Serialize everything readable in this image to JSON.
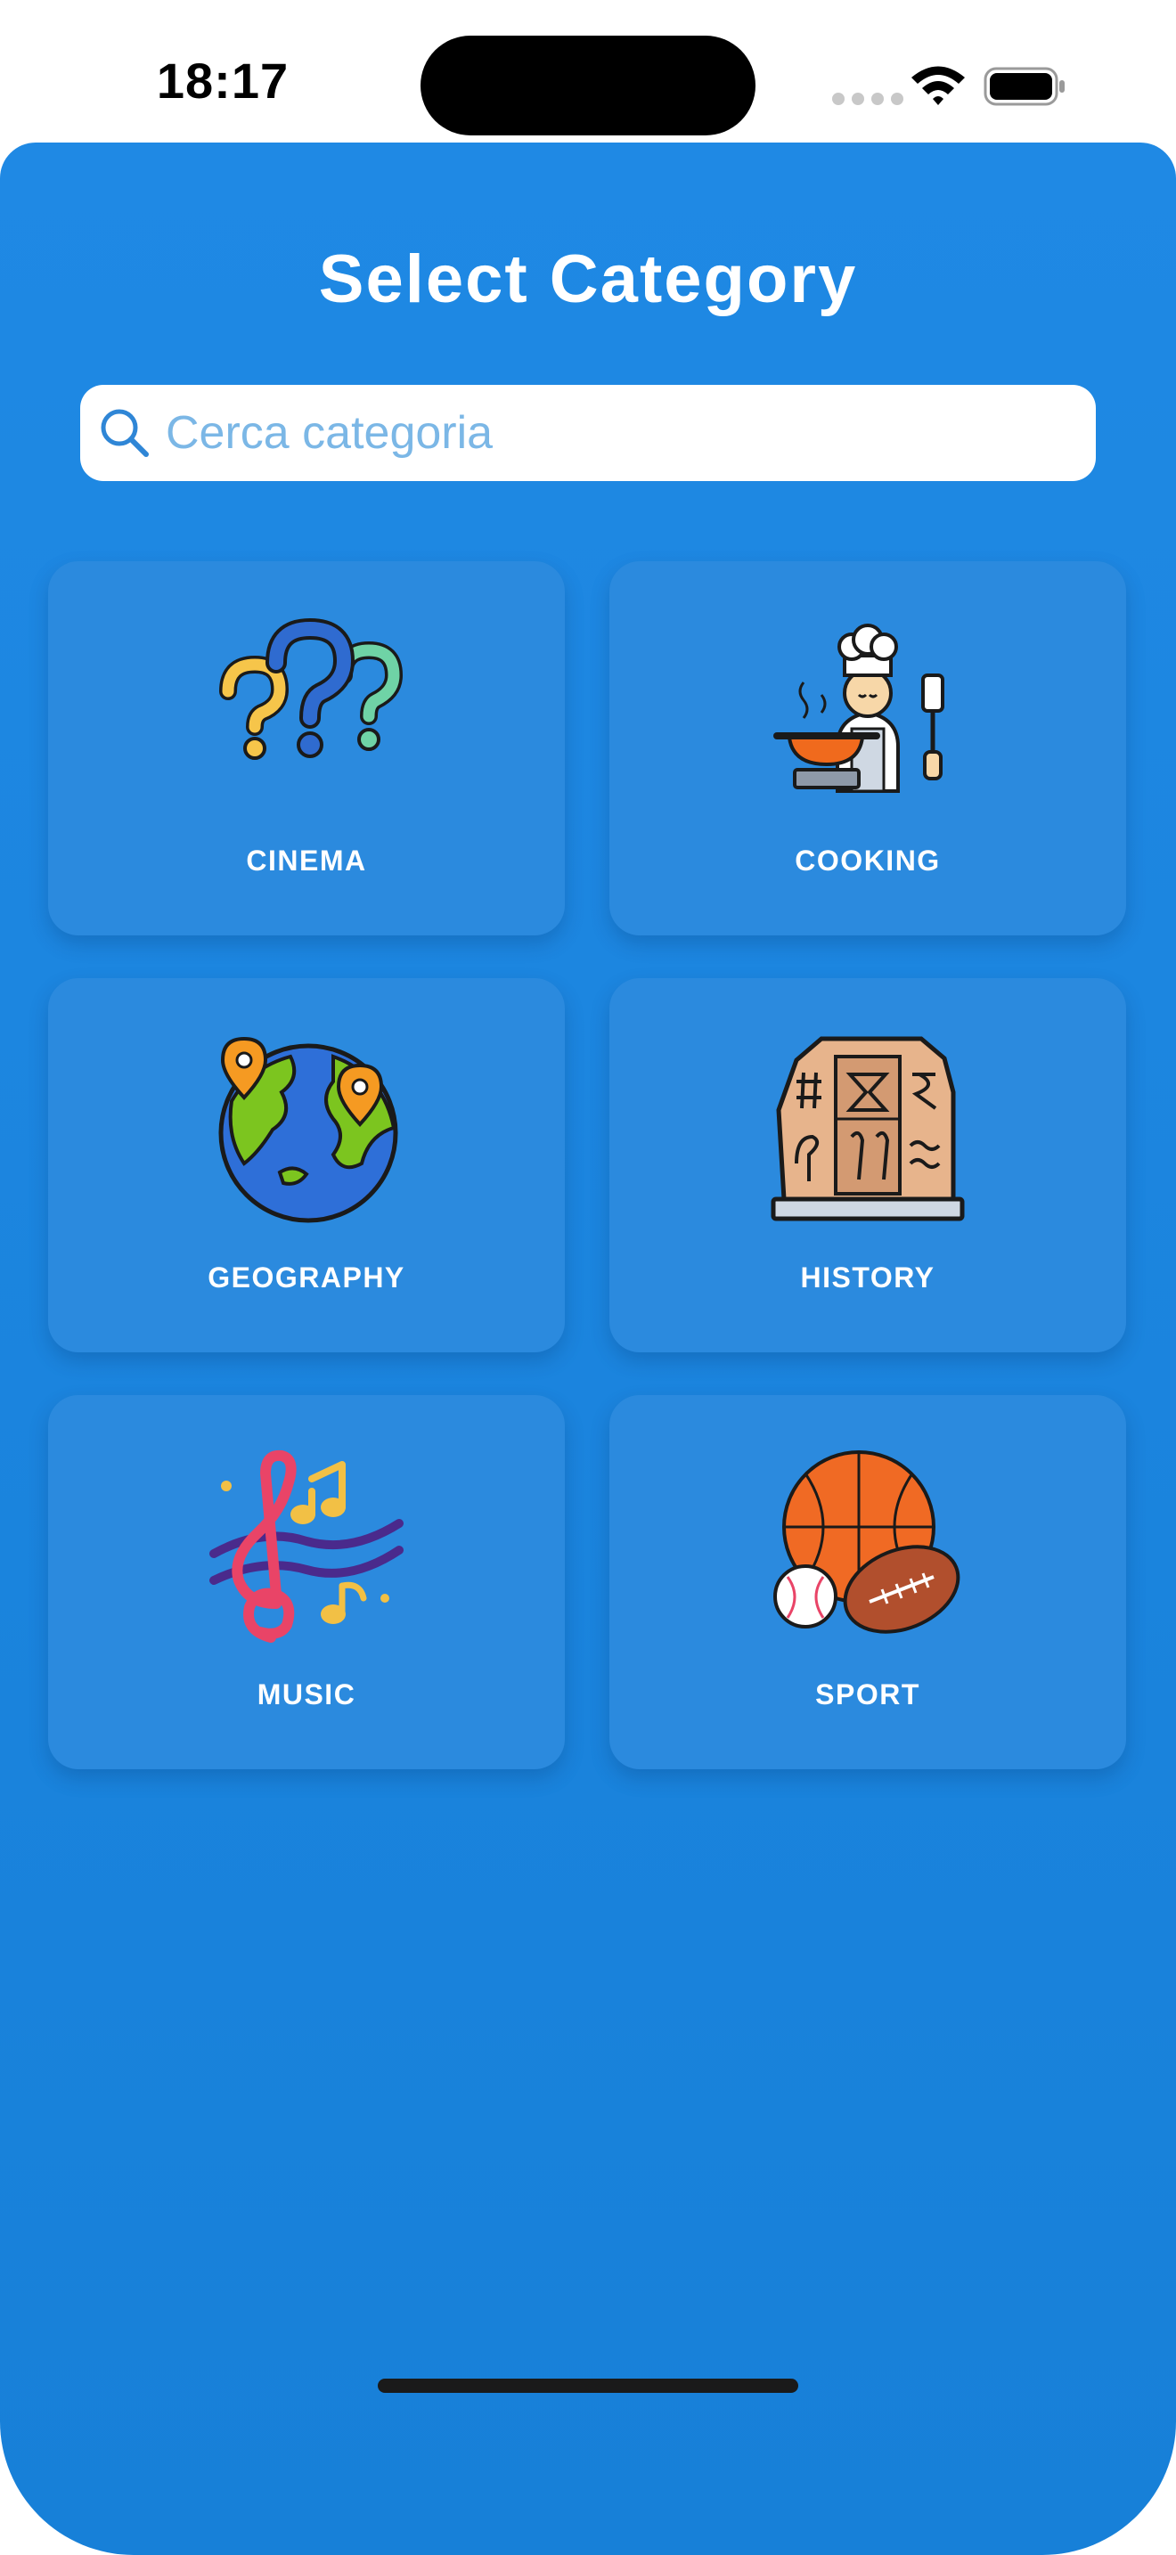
{
  "status_bar": {
    "time": "18:17"
  },
  "header": {
    "title": "Select Category"
  },
  "search": {
    "placeholder": "Cerca categoria",
    "value": ""
  },
  "categories": [
    {
      "label": "CINEMA",
      "icon": "question-marks-icon"
    },
    {
      "label": "COOKING",
      "icon": "chef-icon"
    },
    {
      "label": "GEOGRAPHY",
      "icon": "globe-icon"
    },
    {
      "label": "HISTORY",
      "icon": "stone-tablet-icon"
    },
    {
      "label": "MUSIC",
      "icon": "music-notes-icon"
    },
    {
      "label": "SPORT",
      "icon": "sports-balls-icon"
    }
  ],
  "colors": {
    "background": "#1f89e4",
    "card": "#2b8ade",
    "text": "#ffffff",
    "placeholder": "#7bb7e6"
  }
}
